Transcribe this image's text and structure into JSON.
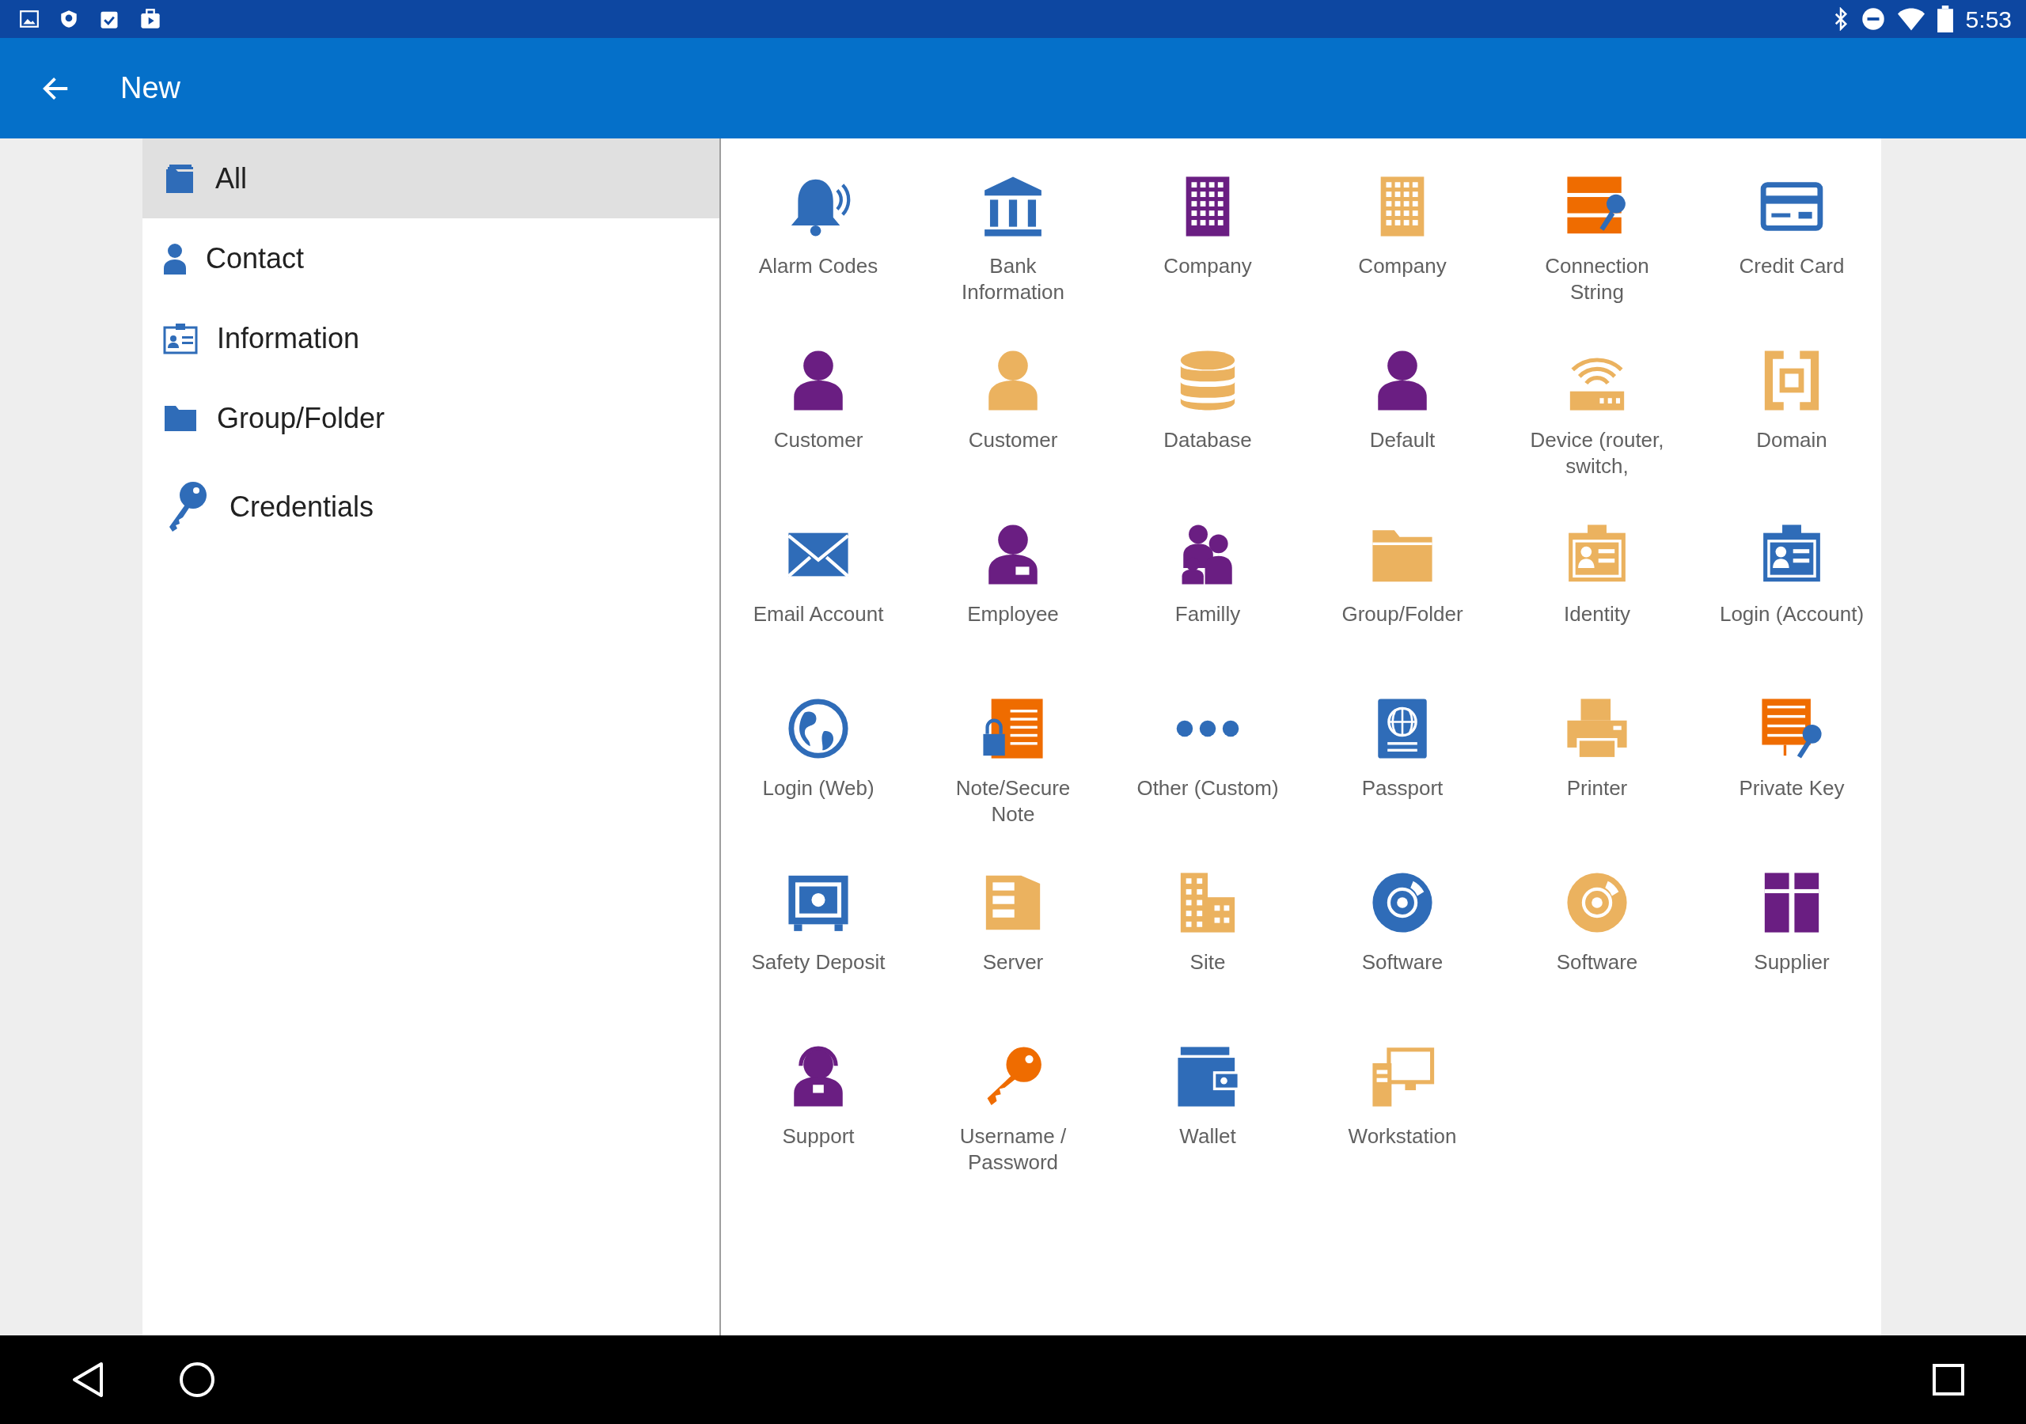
{
  "status_bar": {
    "time": "5:53"
  },
  "app_bar": {
    "title": "New"
  },
  "sidebar": {
    "items": [
      {
        "label": "All",
        "selected": true
      },
      {
        "label": "Contact",
        "selected": false
      },
      {
        "label": "Information",
        "selected": false
      },
      {
        "label": "Group/Folder",
        "selected": false
      },
      {
        "label": "Credentials",
        "selected": false
      }
    ]
  },
  "grid": {
    "items": [
      {
        "label": "Alarm Codes",
        "color": "#2f6cb8"
      },
      {
        "label": "Bank\nInformation",
        "color": "#2f6cb8"
      },
      {
        "label": "Company",
        "color": "#6a1e82"
      },
      {
        "label": "Company",
        "color": "#ebb25f"
      },
      {
        "label": "Connection\nString",
        "color": "#ef6c00"
      },
      {
        "label": "Credit Card",
        "color": "#2f6cb8"
      },
      {
        "label": "Customer",
        "color": "#6a1e82"
      },
      {
        "label": "Customer",
        "color": "#ebb25f"
      },
      {
        "label": "Database",
        "color": "#ebb25f"
      },
      {
        "label": "Default",
        "color": "#6a1e82"
      },
      {
        "label": "Device (router,\nswitch,",
        "color": "#ebb25f"
      },
      {
        "label": "Domain",
        "color": "#ebb25f"
      },
      {
        "label": "Email Account",
        "color": "#2f6cb8"
      },
      {
        "label": "Employee",
        "color": "#6a1e82"
      },
      {
        "label": "Familly",
        "color": "#6a1e82"
      },
      {
        "label": "Group/Folder",
        "color": "#ebb25f"
      },
      {
        "label": "Identity",
        "color": "#ebb25f"
      },
      {
        "label": "Login (Account)",
        "color": "#2f6cb8"
      },
      {
        "label": "Login (Web)",
        "color": "#2f6cb8"
      },
      {
        "label": "Note/Secure\nNote",
        "color": "#ef6c00"
      },
      {
        "label": "Other (Custom)",
        "color": "#2f6cb8"
      },
      {
        "label": "Passport",
        "color": "#2f6cb8"
      },
      {
        "label": "Printer",
        "color": "#ebb25f"
      },
      {
        "label": "Private Key",
        "color": "#ef6c00"
      },
      {
        "label": "Safety Deposit",
        "color": "#2f6cb8"
      },
      {
        "label": "Server",
        "color": "#ebb25f"
      },
      {
        "label": "Site",
        "color": "#ebb25f"
      },
      {
        "label": "Software",
        "color": "#2f6cb8"
      },
      {
        "label": "Software",
        "color": "#ebb25f"
      },
      {
        "label": "Supplier",
        "color": "#6a1e82"
      },
      {
        "label": "Support",
        "color": "#6a1e82"
      },
      {
        "label": "Username /\nPassword",
        "color": "#ef6c00"
      },
      {
        "label": "Wallet",
        "color": "#2f6cb8"
      },
      {
        "label": "Workstation",
        "color": "#ebb25f"
      }
    ]
  }
}
